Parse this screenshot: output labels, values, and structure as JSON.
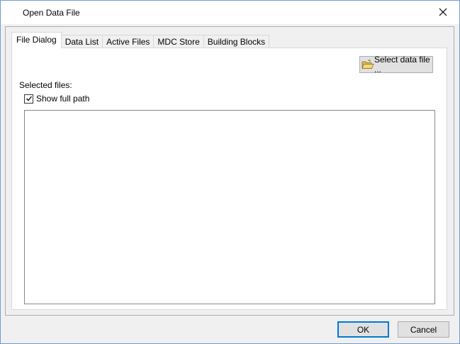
{
  "window": {
    "title": "Open Data File"
  },
  "tabs": [
    {
      "label": "File Dialog",
      "active": true
    },
    {
      "label": "Data List",
      "active": false
    },
    {
      "label": "Active Files",
      "active": false
    },
    {
      "label": "MDC Store",
      "active": false
    },
    {
      "label": "Building Blocks",
      "active": false
    }
  ],
  "file_dialog": {
    "select_button_label": "Select data file ...",
    "selected_files_label": "Selected files:",
    "show_full_path_label": "Show full path",
    "show_full_path_checked": true,
    "selected_files": []
  },
  "footer": {
    "ok_label": "OK",
    "cancel_label": "Cancel"
  },
  "colors": {
    "accent": "#0078d7",
    "folder_icon": "#e8b84a"
  }
}
